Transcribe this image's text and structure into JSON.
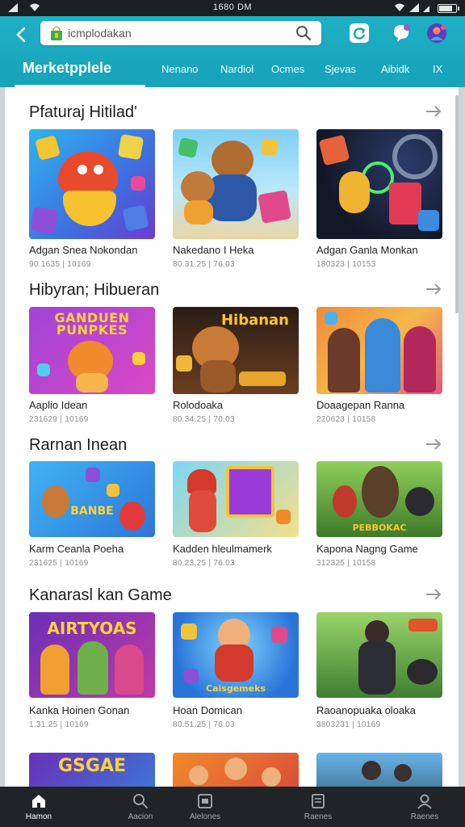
{
  "status": {
    "time": "1680 DM"
  },
  "header": {
    "search_value": "icmplodakan",
    "brand": "Merketpplele",
    "tabs": [
      "Nenano",
      "Nardiol",
      "Ocmes",
      "Sjevas",
      "Aibidk",
      "IX"
    ]
  },
  "sections": [
    {
      "title": "Pfaturaj Hitilad'",
      "cards": [
        {
          "name": "Adgan Snea Nokondan",
          "meta": "90.1635 | 10169"
        },
        {
          "name": "Nakedano I Heka",
          "meta": "80.31.25 | 76.03"
        },
        {
          "name": "Adgan Ganla Monkan",
          "meta": "180323 | 10153"
        }
      ]
    },
    {
      "title": "Hibyran; Hibueran",
      "cards": [
        {
          "name": "Aaplio Idean",
          "meta": "231629 | 10169",
          "headline": "GANDUEN PUNPKES"
        },
        {
          "name": "Rolodoaka",
          "meta": "80.34.25 | 70.03",
          "headline": "Hibanan"
        },
        {
          "name": "Doaagepan Ranna",
          "meta": "220623 | 10158"
        }
      ]
    },
    {
      "title": "Rarnan Inean",
      "cards": [
        {
          "name": "Karm Ceanla Poeha",
          "meta": "231625 | 10169",
          "headline": "BANBE"
        },
        {
          "name": "Kadden hleulmamerk",
          "meta": "80.23.25 | 76.03"
        },
        {
          "name": "Kapona Nagng Game",
          "meta": "312325 | 10158",
          "headline": "PEBBOKAC"
        }
      ]
    },
    {
      "title": "Kanarasl kan Game",
      "cards": [
        {
          "name": "Kanka Hoinen Gonan",
          "meta": "1.31.25 | 10169",
          "headline": "AIRTYOAS"
        },
        {
          "name": "Hoan Domican",
          "meta": "80.51.25 | 76.03",
          "headline": "Caisgemeks"
        },
        {
          "name": "Raoanopuaka oloaka",
          "meta": "3803231 | 10169"
        }
      ]
    },
    {
      "cards": [
        {
          "headline": "GSGAE"
        },
        {},
        {}
      ]
    }
  ],
  "nav": [
    {
      "label": "Hamon",
      "icon": "home-icon"
    },
    {
      "label": "Aacion",
      "icon": "search-icon"
    },
    {
      "label": "Alelones",
      "icon": "apps-icon"
    },
    {
      "label": "Raenes",
      "icon": "library-icon"
    },
    {
      "label": "Raenes",
      "icon": "profile-icon"
    }
  ],
  "colors": {
    "header": "#17a2b8",
    "nav": "#202427"
  }
}
